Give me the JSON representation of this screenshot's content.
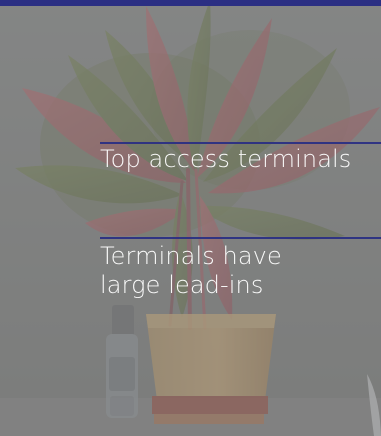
{
  "callouts": [
    {
      "label": "Top access terminals"
    },
    {
      "label": "Terminals have large lead-ins"
    }
  ],
  "colors": {
    "accent": "#2b2f83",
    "overlay_text": "#ffffff",
    "background": "#8a8d87"
  }
}
